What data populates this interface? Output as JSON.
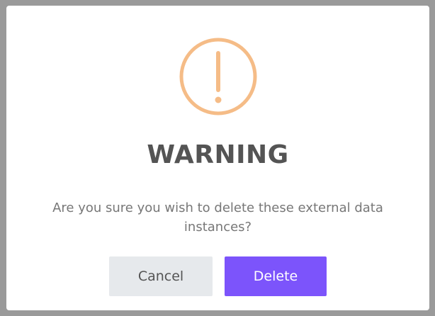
{
  "dialog": {
    "icon": "warning-exclamation-icon",
    "icon_color": "#f5bc87",
    "title": "WARNING",
    "message": "Are you sure you wish to delete these external data instances?",
    "cancel_label": "Cancel",
    "delete_label": "Delete",
    "accent_color": "#7c54fb"
  }
}
